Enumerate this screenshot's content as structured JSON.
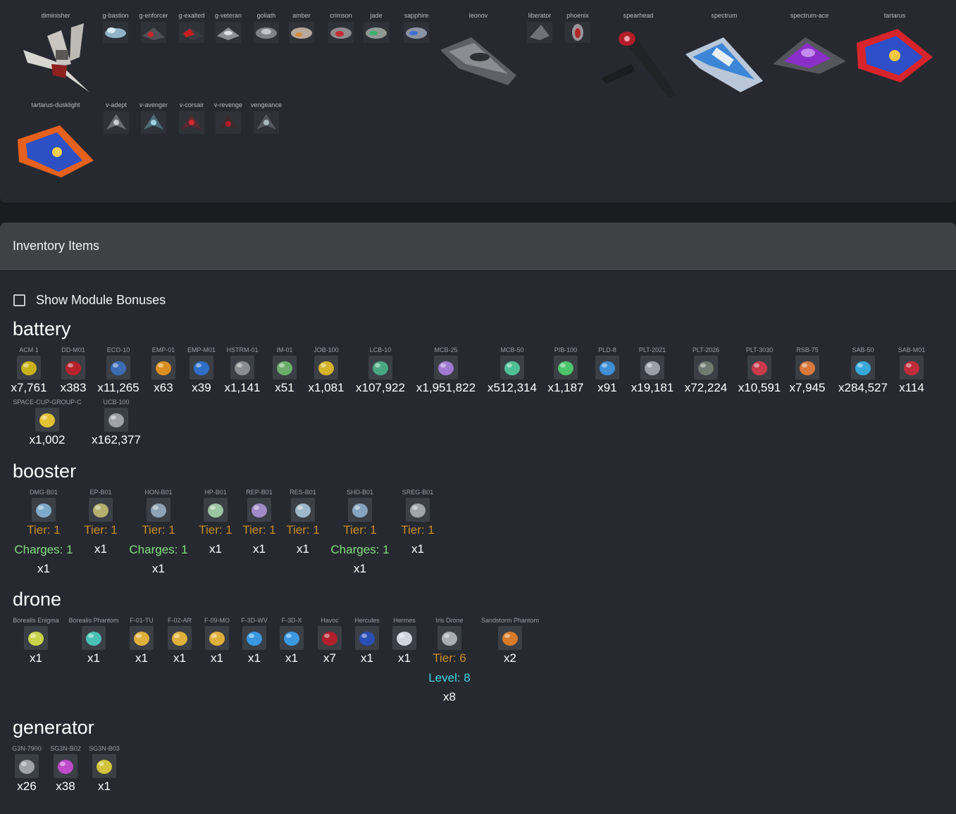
{
  "ships": [
    {
      "name": "diminisher"
    },
    {
      "name": "g-bastion"
    },
    {
      "name": "g-enforcer"
    },
    {
      "name": "g-exalted"
    },
    {
      "name": "g-veteran"
    },
    {
      "name": "goliath"
    },
    {
      "name": "amber"
    },
    {
      "name": "crimson"
    },
    {
      "name": "jade"
    },
    {
      "name": "sapphire"
    },
    {
      "name": "leonov"
    },
    {
      "name": "liberator"
    },
    {
      "name": "phoenix"
    },
    {
      "name": "spearhead"
    },
    {
      "name": "spectrum"
    },
    {
      "name": "spectrum-ace"
    },
    {
      "name": "tartarus"
    },
    {
      "name": "tartarus-dusklight"
    },
    {
      "name": "v-adept"
    },
    {
      "name": "v-avenger"
    },
    {
      "name": "v-corsair"
    },
    {
      "name": "v-revenge"
    },
    {
      "name": "vengeance"
    }
  ],
  "inventory": {
    "title": "Inventory Items",
    "show_bonuses_label": "Show Module Bonuses",
    "categories": {
      "battery": {
        "title": "battery",
        "items": [
          {
            "name": "ACM 1",
            "qty": "x7,761"
          },
          {
            "name": "DD-M01",
            "qty": "x383"
          },
          {
            "name": "ECO-10",
            "qty": "x11,265"
          },
          {
            "name": "EMP-01",
            "qty": "x63"
          },
          {
            "name": "EMP-M01",
            "qty": "x39"
          },
          {
            "name": "HSTRM-01",
            "qty": "x1,141"
          },
          {
            "name": "IM-01",
            "qty": "x51"
          },
          {
            "name": "JOB-100",
            "qty": "x1,081"
          },
          {
            "name": "LCB-10",
            "qty": "x107,922"
          },
          {
            "name": "MCB-25",
            "qty": "x1,951,822"
          },
          {
            "name": "MCB-50",
            "qty": "x512,314"
          },
          {
            "name": "PIB-100",
            "qty": "x1,187"
          },
          {
            "name": "PLD-8",
            "qty": "x91"
          },
          {
            "name": "PLT-2021",
            "qty": "x19,181"
          },
          {
            "name": "PLT-2026",
            "qty": "x72,224"
          },
          {
            "name": "PLT-3030",
            "qty": "x10,591"
          },
          {
            "name": "RSB-75",
            "qty": "x7,945"
          },
          {
            "name": "SAB-50",
            "qty": "x284,527"
          },
          {
            "name": "SAB-M01",
            "qty": "x114"
          },
          {
            "name": "SPACE-CUP-GROUP-C",
            "qty": "x1,002"
          },
          {
            "name": "UCB-100",
            "qty": "x162,377"
          }
        ]
      },
      "booster": {
        "title": "booster",
        "items": [
          {
            "name": "DMG-B01",
            "tier": "Tier: 1",
            "charges": "Charges: 1",
            "qty": "x1"
          },
          {
            "name": "EP-B01",
            "tier": "Tier: 1",
            "qty": "x1"
          },
          {
            "name": "HON-B01",
            "tier": "Tier: 1",
            "charges": "Charges: 1",
            "qty": "x1"
          },
          {
            "name": "HP-B01",
            "tier": "Tier: 1",
            "qty": "x1"
          },
          {
            "name": "REP-B01",
            "tier": "Tier: 1",
            "qty": "x1"
          },
          {
            "name": "RES-B01",
            "tier": "Tier: 1",
            "qty": "x1"
          },
          {
            "name": "SHD-B01",
            "tier": "Tier: 1",
            "charges": "Charges: 1",
            "qty": "x1"
          },
          {
            "name": "SREG-B01",
            "tier": "Tier: 1",
            "qty": "x1"
          }
        ]
      },
      "drone": {
        "title": "drone",
        "items": [
          {
            "name": "Borealis Enigma",
            "qty": "x1"
          },
          {
            "name": "Borealis Phantom",
            "qty": "x1"
          },
          {
            "name": "F-01-TU",
            "qty": "x1"
          },
          {
            "name": "F-02-AR",
            "qty": "x1"
          },
          {
            "name": "F-09-MO",
            "qty": "x1"
          },
          {
            "name": "F-3D-WV",
            "qty": "x1"
          },
          {
            "name": "F-3D-X",
            "qty": "x1"
          },
          {
            "name": "Havoc",
            "qty": "x7"
          },
          {
            "name": "Hercules",
            "qty": "x1"
          },
          {
            "name": "Hermes",
            "qty": "x1"
          },
          {
            "name": "Iris Drone",
            "tier": "Tier: 6",
            "level": "Level: 8",
            "qty": "x8"
          },
          {
            "name": "Sandstorm Phantom",
            "qty": "x2"
          }
        ]
      },
      "generator": {
        "title": "generator",
        "items": [
          {
            "name": "G3N-7900",
            "qty": "x26"
          },
          {
            "name": "SG3N-B02",
            "qty": "x38"
          },
          {
            "name": "SG3N-B03",
            "qty": "x1"
          }
        ]
      }
    }
  },
  "colors": {
    "panel": "#272930",
    "header": "#404145",
    "tier": "#c98e23",
    "charges": "#7fe07c",
    "level": "#3fd7e6"
  }
}
